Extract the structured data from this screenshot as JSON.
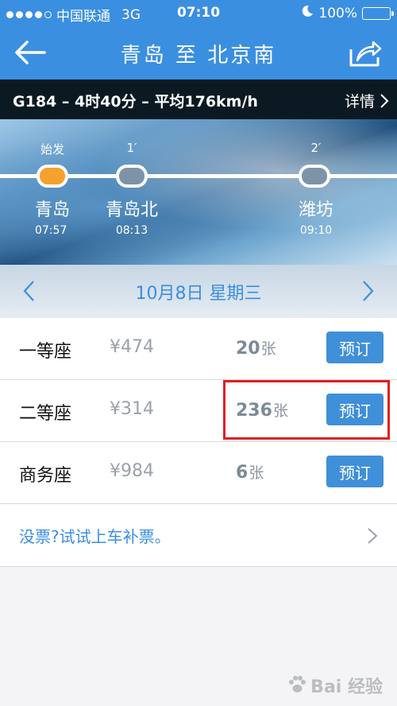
{
  "status_bar": {
    "carrier": "中国联通",
    "network": "3G",
    "time": "07:10",
    "battery": "100%",
    "signal_level": 0.8
  },
  "nav": {
    "title": "青岛 至 北京南",
    "back_icon": "back-arrow-icon",
    "share_icon": "share-icon"
  },
  "train": {
    "summary": "G184 – 4时40分 – 平均176km/h",
    "detail_label": "详情"
  },
  "route": {
    "stations": [
      {
        "label": "始发",
        "name": "青岛",
        "time": "07:57",
        "active": true
      },
      {
        "label": "1′",
        "name": "青岛北",
        "time": "08:13",
        "active": false
      },
      {
        "label": "2′",
        "name": "潍坊",
        "time": "09:10",
        "active": false
      }
    ]
  },
  "date": {
    "label": "10月8日 星期三"
  },
  "seats": [
    {
      "type": "一等座",
      "price": "¥474",
      "count": "20",
      "unit": "张",
      "button": "预订"
    },
    {
      "type": "二等座",
      "price": "¥314",
      "count": "236",
      "unit": "张",
      "button": "预订"
    },
    {
      "type": "商务座",
      "price": "¥984",
      "count": "6",
      "unit": "张",
      "button": "预订"
    }
  ],
  "no_ticket": {
    "text": "没票?试试上车补票。"
  },
  "watermark": {
    "text": "Bai 经验"
  },
  "colors": {
    "primary": "#3b8fe0",
    "dark_bar": "#0b1a22",
    "active_station": "#f4a22d",
    "highlight": "#e01e25"
  }
}
